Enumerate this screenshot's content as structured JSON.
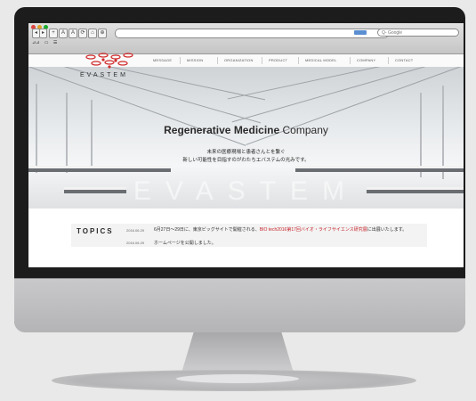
{
  "browser": {
    "nav_buttons": [
      "◂",
      "▸",
      "+",
      "A",
      "A",
      "⟳",
      "⌂",
      "⊕"
    ],
    "search_placeholder": "Q- Google",
    "bookmarks": [
      "⊿⊿",
      "▭",
      "☰"
    ]
  },
  "site": {
    "logo_text": "EVASTEM",
    "nav": [
      "MESSAGE",
      "MISSION",
      "ORGANIZATION",
      "PRODUCT",
      "MEDICAL MODEL",
      "COMPANY",
      "CONTACT"
    ],
    "hero": {
      "title_bold": "Regenerative Medicine",
      "title_rest": " Company",
      "sub1": "未来の医療現場と患者さんとを繋ぐ",
      "sub2": "新しい可能性を目指すのがわたちエバステムの光みです。",
      "watermark": "EVASTEM"
    },
    "topics": {
      "heading": "TOPICS",
      "items": [
        {
          "date": "2016.06.29",
          "text_a": "6月27日〜29日に、東京ビッグサイトで開催される、",
          "text_hl": "BIO tech2016第17回バイオ・ライフサイエンス研究展",
          "text_b": "に出展いたします。"
        },
        {
          "date": "2016.06.29",
          "text_a": "ホームページを公開しました。",
          "text_hl": "",
          "text_b": ""
        }
      ]
    }
  }
}
